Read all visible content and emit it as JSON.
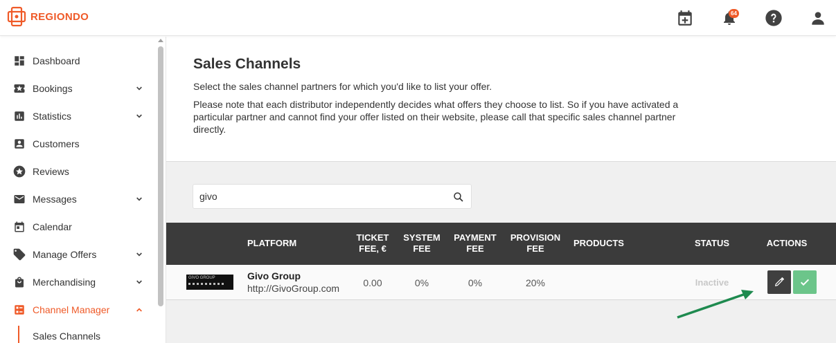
{
  "brand": {
    "name": "REGIONDO",
    "accent": "#ef5a28"
  },
  "topbar": {
    "icons": [
      "calendar-add-icon",
      "bell-icon",
      "help-icon",
      "user-icon"
    ],
    "notifications_count": "64"
  },
  "sidebar": {
    "items": [
      {
        "label": "Dashboard",
        "icon": "dashboard-icon"
      },
      {
        "label": "Bookings",
        "icon": "ticket-icon"
      },
      {
        "label": "Statistics",
        "icon": "chart-icon"
      },
      {
        "label": "Customers",
        "icon": "person-icon"
      },
      {
        "label": "Reviews",
        "icon": "star-icon"
      },
      {
        "label": "Messages",
        "icon": "mail-icon"
      },
      {
        "label": "Calendar",
        "icon": "calendar-icon"
      },
      {
        "label": "Manage Offers",
        "icon": "tag-icon"
      },
      {
        "label": "Merchandising",
        "icon": "bag-icon"
      },
      {
        "label": "Channel Manager",
        "icon": "channel-icon"
      }
    ],
    "sub_item": "Sales Channels"
  },
  "page": {
    "title": "Sales Channels",
    "intro": "Select the sales channel partners for which you'd like to list your offer.",
    "note": "Please note that each distributor independently decides what offers they choose to list. So if you have activated a particular partner and cannot find your offer listed on their website, please call that specific sales channel partner directly."
  },
  "search": {
    "value": "givo"
  },
  "table": {
    "headers": {
      "platform": "PLATFORM",
      "ticket_fee_1": "TICKET",
      "ticket_fee_2": "FEE, €",
      "system_fee_1": "SYSTEM",
      "system_fee_2": "FEE",
      "payment_fee_1": "PAYMENT",
      "payment_fee_2": "FEE",
      "provision_fee_1": "PROVISION",
      "provision_fee_2": "FEE",
      "products": "PRODUCTS",
      "status": "STATUS",
      "actions": "ACTIONS"
    },
    "rows": [
      {
        "logo_text": "GIVO GROUP",
        "name": "Givo Group",
        "url": "http://GivoGroup.com",
        "ticket_fee": "0.00",
        "system_fee": "0%",
        "payment_fee": "0%",
        "provision_fee": "20%",
        "products": "",
        "status": "Inactive"
      }
    ]
  }
}
